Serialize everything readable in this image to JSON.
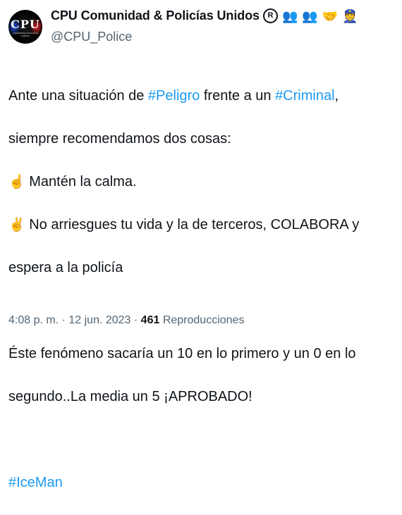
{
  "account": {
    "display_name": "CPU Comunidad & Policías Unidos",
    "registered_mark": "R",
    "name_emojis": [
      "👥",
      "👥",
      "🤝",
      "👮"
    ],
    "handle": "@CPU_Police",
    "avatar_text": "CPU",
    "avatar_subtext": "COMUNIDAD & POLICÍAS UNIDOS"
  },
  "tweet": {
    "l1_pre": "Ante una situación de ",
    "l1_tag1": "#Peligro",
    "l1_mid": " frente a un ",
    "l1_tag2": "#Criminal",
    "l1_post": ",",
    "l2": "siempre recomendamos dos cosas:",
    "l3_icon": "☝️",
    "l3": "Mantén la calma.",
    "l4_icon": "✌️",
    "l4": "No arriesgues tu vida y la de terceros, COLABORA y",
    "l5": "espera a la policía",
    "l6": "Éste fenómeno sacaría un 10 en lo primero y un 0 en lo",
    "l7": "segundo..La media un 5 ¡APROBADO!",
    "hashtag": "#IceMan"
  },
  "meta": {
    "time": "4:08 p. m.",
    "sep1": " · ",
    "date": "12 jun. 2023",
    "sep2": " · ",
    "views_count": "461",
    "views_label": " Reproducciones"
  },
  "colors": {
    "link": "#1d9bf0",
    "text": "#0f1419",
    "secondary": "#536471"
  }
}
